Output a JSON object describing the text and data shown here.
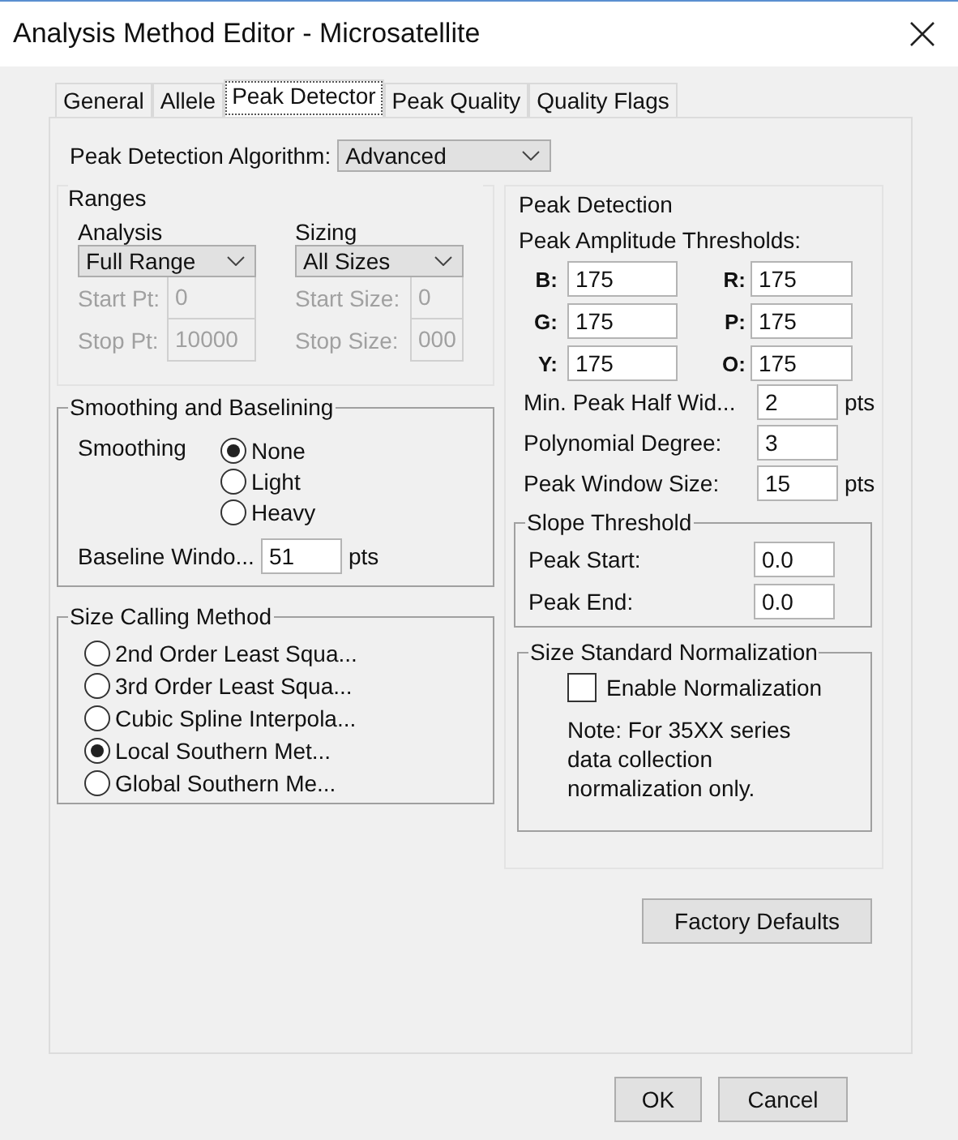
{
  "window": {
    "title": "Analysis Method Editor - Microsatellite"
  },
  "tabs": [
    {
      "label": "General",
      "selected": false
    },
    {
      "label": "Allele",
      "selected": false
    },
    {
      "label": "Peak Detector",
      "selected": true
    },
    {
      "label": "Peak Quality",
      "selected": false
    },
    {
      "label": "Quality Flags",
      "selected": false
    }
  ],
  "algorithm": {
    "label": "Peak Detection Algorithm:",
    "value": "Advanced"
  },
  "ranges": {
    "title": "Ranges",
    "columns": [
      {
        "label": "Analysis",
        "value": "Full Range",
        "fields": [
          {
            "label": "Start Pt:",
            "value": "0",
            "disabled": true
          },
          {
            "label": "Stop Pt:",
            "value": "10000",
            "disabled": true
          }
        ]
      },
      {
        "label": "Sizing",
        "value": "All Sizes",
        "fields": [
          {
            "label": "Start Size:",
            "value": "0",
            "disabled": true
          },
          {
            "label": "Stop Size:",
            "value": "000",
            "disabled": true
          }
        ]
      }
    ]
  },
  "smoothing": {
    "title": "Smoothing and Baselining",
    "label": "Smoothing",
    "options": [
      {
        "label": "None",
        "selected": true
      },
      {
        "label": "Light",
        "selected": false
      },
      {
        "label": "Heavy",
        "selected": false
      }
    ],
    "baseline": {
      "label": "Baseline Windo...",
      "value": "51",
      "unit": "pts"
    }
  },
  "size_calling": {
    "title": "Size Calling Method",
    "options": [
      {
        "label": "2nd Order Least Squa...",
        "selected": false
      },
      {
        "label": "3rd Order Least Squa...",
        "selected": false
      },
      {
        "label": "Cubic Spline Interpola...",
        "selected": false
      },
      {
        "label": "Local Southern Met...",
        "selected": true
      },
      {
        "label": "Global Southern Me...",
        "selected": false
      }
    ]
  },
  "peak_detection": {
    "title": "Peak Detection",
    "thresholds_label": "Peak Amplitude Thresholds:",
    "thresholds": [
      {
        "label": "B:",
        "value": "175"
      },
      {
        "label": "R:",
        "value": "175"
      },
      {
        "label": "G:",
        "value": "175"
      },
      {
        "label": "P:",
        "value": "175"
      },
      {
        "label": "Y:",
        "value": "175"
      },
      {
        "label": "O:",
        "value": "175"
      }
    ],
    "params": [
      {
        "label": "Min. Peak Half Wid...",
        "value": "2",
        "unit": "pts"
      },
      {
        "label": "Polynomial Degree:",
        "value": "3"
      },
      {
        "label": "Peak Window Size:",
        "value": "15",
        "unit": "pts"
      }
    ],
    "slope": {
      "title": "Slope Threshold",
      "fields": [
        {
          "label": "Peak Start:",
          "value": "0.0"
        },
        {
          "label": "Peak End:",
          "value": "0.0"
        }
      ]
    },
    "normalization": {
      "title": "Size Standard Normalization",
      "checkbox": {
        "label": "Enable Normalization",
        "checked": false
      },
      "note": "Note: For 35XX series data collection normalization only."
    }
  },
  "factory_defaults": "Factory Defaults",
  "buttons": [
    "OK",
    "Cancel"
  ]
}
